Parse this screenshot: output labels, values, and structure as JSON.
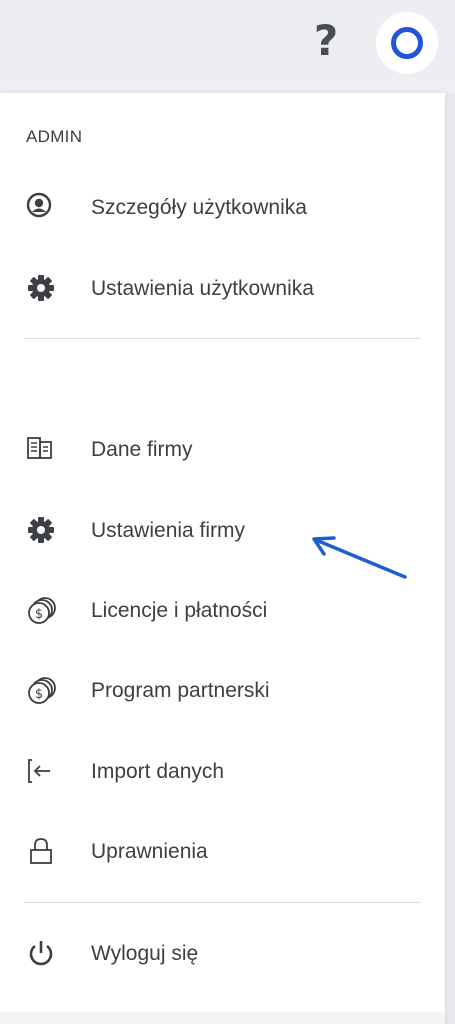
{
  "header": {
    "help_label": "?",
    "avatar_label": "User avatar"
  },
  "menu": {
    "section_title": "ADMIN",
    "user_items": [
      {
        "label": "Szczegóły użytkownika",
        "icon": "user-circle-icon"
      },
      {
        "label": "Ustawienia użytkownika",
        "icon": "gear-icon"
      }
    ],
    "company_items": [
      {
        "label": "Dane firmy",
        "icon": "building-icon"
      },
      {
        "label": "Ustawienia firmy",
        "icon": "gear-icon"
      },
      {
        "label": "Licencje i płatności",
        "icon": "coins-icon"
      },
      {
        "label": "Program partnerski",
        "icon": "coins-icon"
      },
      {
        "label": "Import danych",
        "icon": "import-icon"
      },
      {
        "label": "Uprawnienia",
        "icon": "lock-icon"
      }
    ],
    "logout": {
      "label": "Wyloguj się",
      "icon": "power-icon"
    }
  },
  "annotation": {
    "arrow_color": "#1d5fcf",
    "accent": "#1f55d6"
  }
}
